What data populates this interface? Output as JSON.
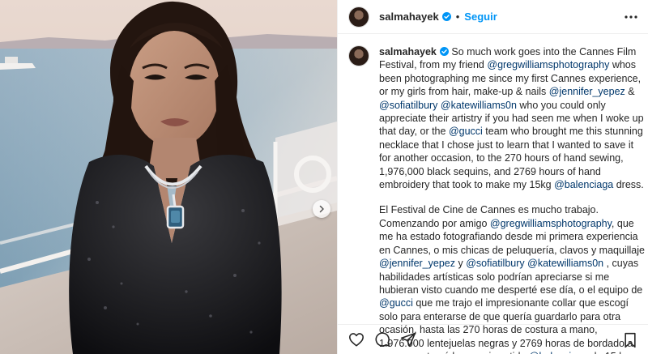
{
  "post": {
    "username": "salmahayek",
    "follow_label": "Seguir",
    "separator": "•",
    "caption": {
      "en": [
        {
          "t": "So much work goes into the Cannes Film Festival, from my friend "
        },
        {
          "m": "@gregwilliamsphotography"
        },
        {
          "t": " whos been photographing me since my first Cannes experience, or my girls from hair, make-up & nails "
        },
        {
          "m": "@jennifer_yepez"
        },
        {
          "t": " & "
        },
        {
          "m": "@sofiatilbury"
        },
        {
          "t": " "
        },
        {
          "m": "@katewilliams0n"
        },
        {
          "t": " who you could only appreciate their artistry if you had seen me when I woke up that day, or the "
        },
        {
          "m": "@gucci"
        },
        {
          "t": " team who brought me this stunning necklace that I chose just to learn that I wanted to save it for another occasion, to the 270 hours of hand sewing, 1,976,000 black sequins, and 2769 hours of hand embroidery that took to make my 15kg "
        },
        {
          "m": "@balenciaga"
        },
        {
          "t": " dress."
        }
      ],
      "es": [
        {
          "t": "El Festival de Cine de Cannes es mucho trabajo. Comenzando por amigo "
        },
        {
          "m": "@gregwilliamsphotography"
        },
        {
          "t": ", que me ha estado fotografiando desde mi primera experiencia en Cannes, o mis chicas de peluquería, clavos y maquillaje "
        },
        {
          "m": "@jennifer_yepez"
        },
        {
          "t": " y "
        },
        {
          "m": "@sofiatilbury"
        },
        {
          "t": " "
        },
        {
          "m": "@katewilliams0n"
        },
        {
          "t": " , cuyas habilidades artísticas solo podrían apreciarse si me hubieran visto cuando me desperté ese día, o el equipo de "
        },
        {
          "m": "@gucci"
        },
        {
          "t": " que me trajo el impresionante collar que escogí solo para enterarse de que quería guardarlo para otra ocasión, hasta las 270 horas de costura a mano, 1.976.000 lentejuelas negras y 2769 horas de bordado a mano que tomó hacer mi vestido "
        },
        {
          "m": "@balenciaga"
        },
        {
          "t": " de 15 kg."
        }
      ]
    }
  },
  "icons": {
    "verified": "verified-badge-icon",
    "more": "more-options-icon",
    "next": "chevron-right-icon",
    "like": "heart-icon",
    "comment": "comment-icon",
    "share": "paper-plane-icon",
    "save": "bookmark-icon"
  },
  "colors": {
    "accent": "#0095f6",
    "mention": "#00376b",
    "text": "#262626",
    "border": "#efefef"
  }
}
